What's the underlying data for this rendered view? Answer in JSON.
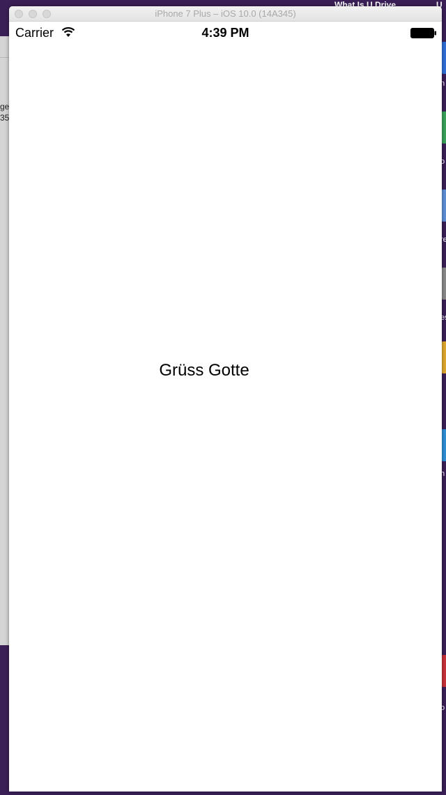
{
  "simulator": {
    "title": "iPhone 7 Plus – iOS 10.0 (14A345)"
  },
  "status_bar": {
    "carrier": "Carrier",
    "time": "4:39 PM",
    "icons": [
      "wifi-icon",
      "battery-icon"
    ]
  },
  "screen": {
    "label_text": "Grüss Gotte"
  },
  "desktop": {
    "menu_text_1": "What Is U Drive",
    "menu_text_2": "U",
    "left_window_text_1": "ge",
    "left_window_text_2": "35",
    "icon_labels": [
      "n",
      "u",
      "o",
      "re",
      "es",
      "l",
      "h",
      "o"
    ],
    "colors": {
      "background": "#3a1f57",
      "simulator_title": "#a8a8a8"
    }
  }
}
